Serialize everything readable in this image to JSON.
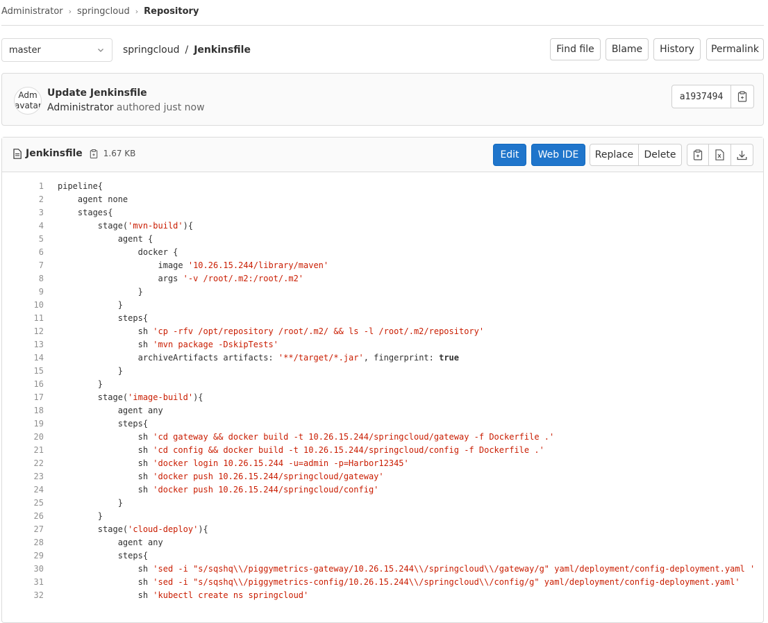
{
  "breadcrumb": [
    "Administrator",
    "springcloud",
    "Repository"
  ],
  "branch": {
    "selected": "master"
  },
  "path": {
    "project": "springcloud",
    "separator": "/",
    "file": "Jenkinsfile"
  },
  "file_actions": {
    "find_file": "Find file",
    "blame": "Blame",
    "history": "History",
    "permalink": "Permalink"
  },
  "commit": {
    "avatar_text": "Adm avatar",
    "title": "Update Jenkinsfile",
    "author": "Administrator",
    "meta": "authored just now",
    "sha": "a1937494"
  },
  "file": {
    "name": "Jenkinsfile",
    "size": "1.67 KB",
    "buttons": {
      "edit": "Edit",
      "web_ide": "Web IDE",
      "replace": "Replace",
      "delete": "Delete"
    }
  },
  "code_lines": [
    [
      {
        "t": "pipeline{"
      }
    ],
    [
      {
        "t": "    agent none"
      }
    ],
    [
      {
        "t": "    stages{"
      }
    ],
    [
      {
        "t": "        stage("
      },
      {
        "t": "'mvn-build'",
        "c": "s"
      },
      {
        "t": "){"
      }
    ],
    [
      {
        "t": "            agent {"
      }
    ],
    [
      {
        "t": "                docker {"
      }
    ],
    [
      {
        "t": "                    image "
      },
      {
        "t": "'10.26.15.244/library/maven'",
        "c": "s"
      }
    ],
    [
      {
        "t": "                    args "
      },
      {
        "t": "'-v /root/.m2:/root/.m2'",
        "c": "s"
      }
    ],
    [
      {
        "t": "                }"
      }
    ],
    [
      {
        "t": "            }"
      }
    ],
    [
      {
        "t": "            steps{"
      }
    ],
    [
      {
        "t": "                sh "
      },
      {
        "t": "'cp -rfv /opt/repository /root/.m2/ && ls -l /root/.m2/repository'",
        "c": "s"
      }
    ],
    [
      {
        "t": "                sh "
      },
      {
        "t": "'mvn package -DskipTests'",
        "c": "s"
      }
    ],
    [
      {
        "t": "                archiveArtifacts artifacts: "
      },
      {
        "t": "'**/target/*.jar'",
        "c": "s"
      },
      {
        "t": ", fingerprint: "
      },
      {
        "t": "true",
        "c": "kw"
      }
    ],
    [
      {
        "t": "            }"
      }
    ],
    [
      {
        "t": "        }"
      }
    ],
    [
      {
        "t": "        stage("
      },
      {
        "t": "'image-build'",
        "c": "s"
      },
      {
        "t": "){"
      }
    ],
    [
      {
        "t": "            agent any"
      }
    ],
    [
      {
        "t": "            steps{"
      }
    ],
    [
      {
        "t": "                sh "
      },
      {
        "t": "'cd gateway && docker build -t 10.26.15.244/springcloud/gateway -f Dockerfile .'",
        "c": "s"
      }
    ],
    [
      {
        "t": "                sh "
      },
      {
        "t": "'cd config && docker build -t 10.26.15.244/springcloud/config -f Dockerfile .'",
        "c": "s"
      }
    ],
    [
      {
        "t": "                sh "
      },
      {
        "t": "'docker login 10.26.15.244 -u=admin -p=Harbor12345'",
        "c": "s"
      }
    ],
    [
      {
        "t": "                sh "
      },
      {
        "t": "'docker push 10.26.15.244/springcloud/gateway'",
        "c": "s"
      }
    ],
    [
      {
        "t": "                sh "
      },
      {
        "t": "'docker push 10.26.15.244/springcloud/config'",
        "c": "s"
      }
    ],
    [
      {
        "t": "            }"
      }
    ],
    [
      {
        "t": "        }"
      }
    ],
    [
      {
        "t": "        stage("
      },
      {
        "t": "'cloud-deploy'",
        "c": "s"
      },
      {
        "t": "){"
      }
    ],
    [
      {
        "t": "            agent any"
      }
    ],
    [
      {
        "t": "            steps{"
      }
    ],
    [
      {
        "t": "                sh "
      },
      {
        "t": "'sed -i \"s/sqshq\\\\/piggymetrics-gateway/10.26.15.244\\\\/springcloud\\\\/gateway/g\" yaml/deployment/config-deployment.yaml '",
        "c": "s"
      }
    ],
    [
      {
        "t": "                sh "
      },
      {
        "t": "'sed -i \"s/sqshq\\\\/piggymetrics-config/10.26.15.244\\\\/springcloud\\\\/config/g\" yaml/deployment/config-deployment.yaml'",
        "c": "s"
      }
    ],
    [
      {
        "t": "                sh "
      },
      {
        "t": "'kubectl create ns springcloud'",
        "c": "s"
      }
    ]
  ]
}
